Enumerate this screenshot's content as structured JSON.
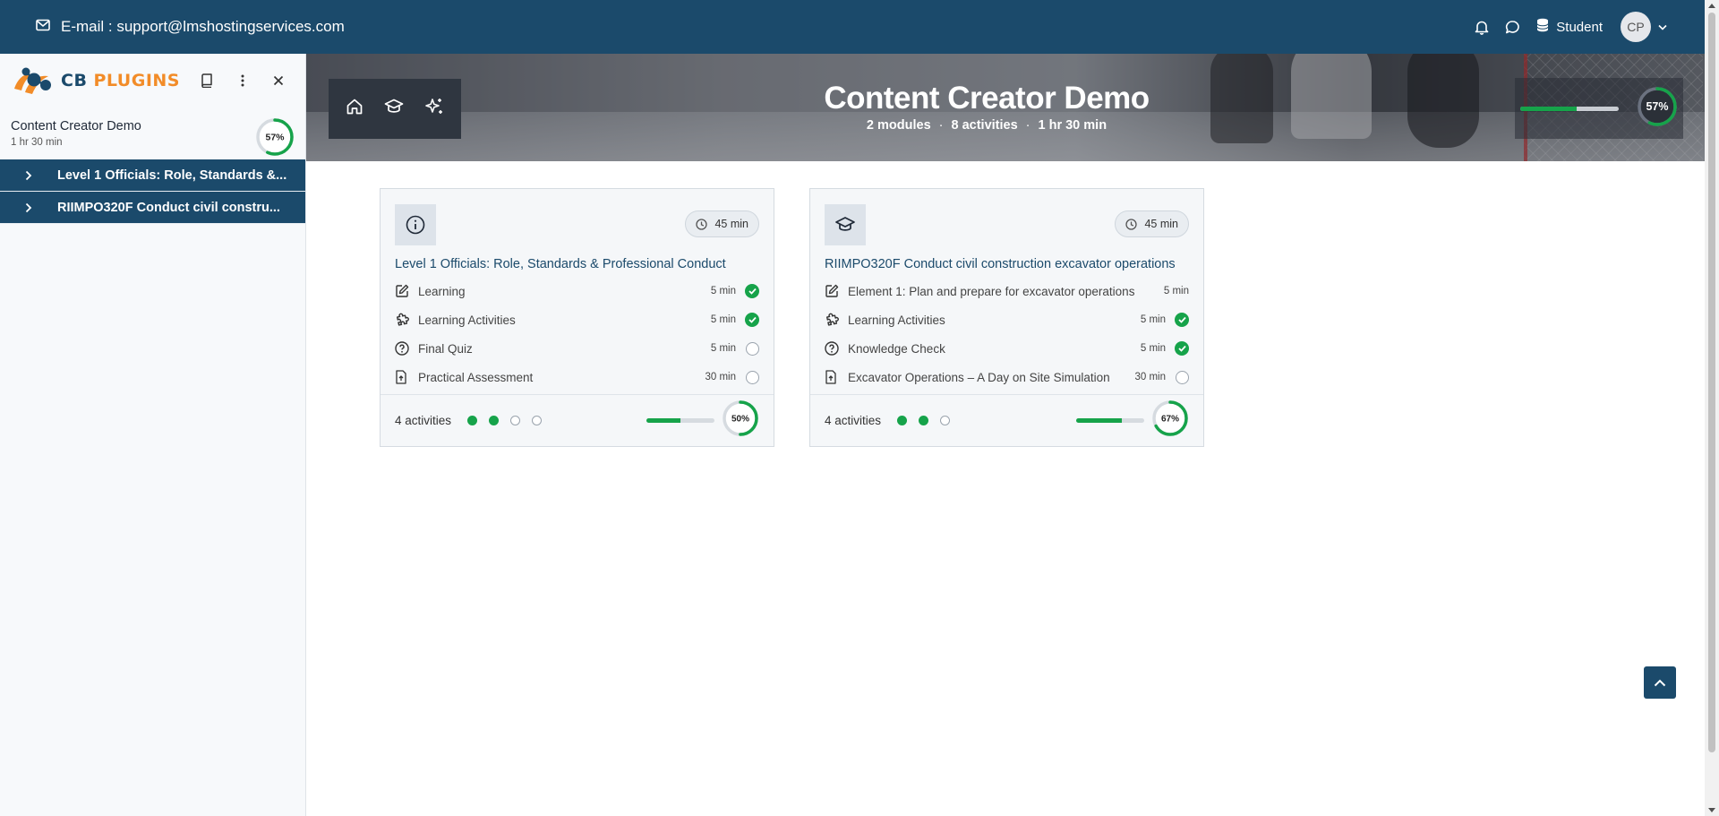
{
  "topbar": {
    "email_text": "E-mail : support@lmshostingservices.com",
    "role_label": "Student",
    "avatar_initials": "CP",
    "icons": [
      "mail-icon",
      "bell-icon",
      "chat-icon",
      "database-icon",
      "chevron-down-icon"
    ]
  },
  "sidebar": {
    "logo": {
      "word1": "CB",
      "word2": "PLUGINS"
    },
    "course": {
      "title": "Content Creator Demo",
      "duration": "1 hr 30 min",
      "progress_label": "57%",
      "progress": 0.57
    },
    "modules": [
      {
        "label": "Level 1 Officials: Role, Standards &..."
      },
      {
        "label": "RIIMPO320F Conduct civil constru..."
      }
    ]
  },
  "hero": {
    "title": "Content Creator Demo",
    "meta": {
      "modules": "2 modules",
      "activities": "8 activities",
      "duration": "1 hr 30 min",
      "separator": "·"
    },
    "progress_label": "57%",
    "progress": 0.57
  },
  "cards": [
    {
      "icon": "info-icon",
      "duration": "45 min",
      "title": "Level 1 Officials: Role, Standards & Professional Conduct",
      "activities": [
        {
          "icon": "edit-icon",
          "label": "Learning",
          "time": "5 min",
          "done": true
        },
        {
          "icon": "puzzle-icon",
          "label": "Learning Activities",
          "time": "5 min",
          "done": true
        },
        {
          "icon": "question-icon",
          "label": "Final Quiz",
          "time": "5 min",
          "done": false
        },
        {
          "icon": "file-upload-icon",
          "label": "Practical Assessment",
          "time": "30 min",
          "done": false
        }
      ],
      "footer": {
        "count": "4 activities",
        "dots": [
          true,
          true,
          false,
          false
        ],
        "progress_label": "50%",
        "progress": 0.5
      }
    },
    {
      "icon": "graduation-cap-icon",
      "duration": "45 min",
      "title": "RIIMPO320F Conduct civil construction excavator operations",
      "activities": [
        {
          "icon": "edit-icon",
          "label": "Element 1: Plan and prepare for excavator operations",
          "time": "5 min",
          "done": null
        },
        {
          "icon": "puzzle-icon",
          "label": "Learning Activities",
          "time": "5 min",
          "done": true
        },
        {
          "icon": "question-icon",
          "label": "Knowledge Check",
          "time": "5 min",
          "done": true
        },
        {
          "icon": "file-upload-icon",
          "label": "Excavator Operations – A Day on Site Simulation",
          "time": "30 min",
          "done": false
        }
      ],
      "footer": {
        "count": "4 activities",
        "dots": [
          true,
          true,
          false
        ],
        "progress_label": "67%",
        "progress": 0.67
      }
    }
  ],
  "colors": {
    "primary": "#1b4a6b",
    "success": "#16a34a",
    "accent": "#f28c28"
  }
}
